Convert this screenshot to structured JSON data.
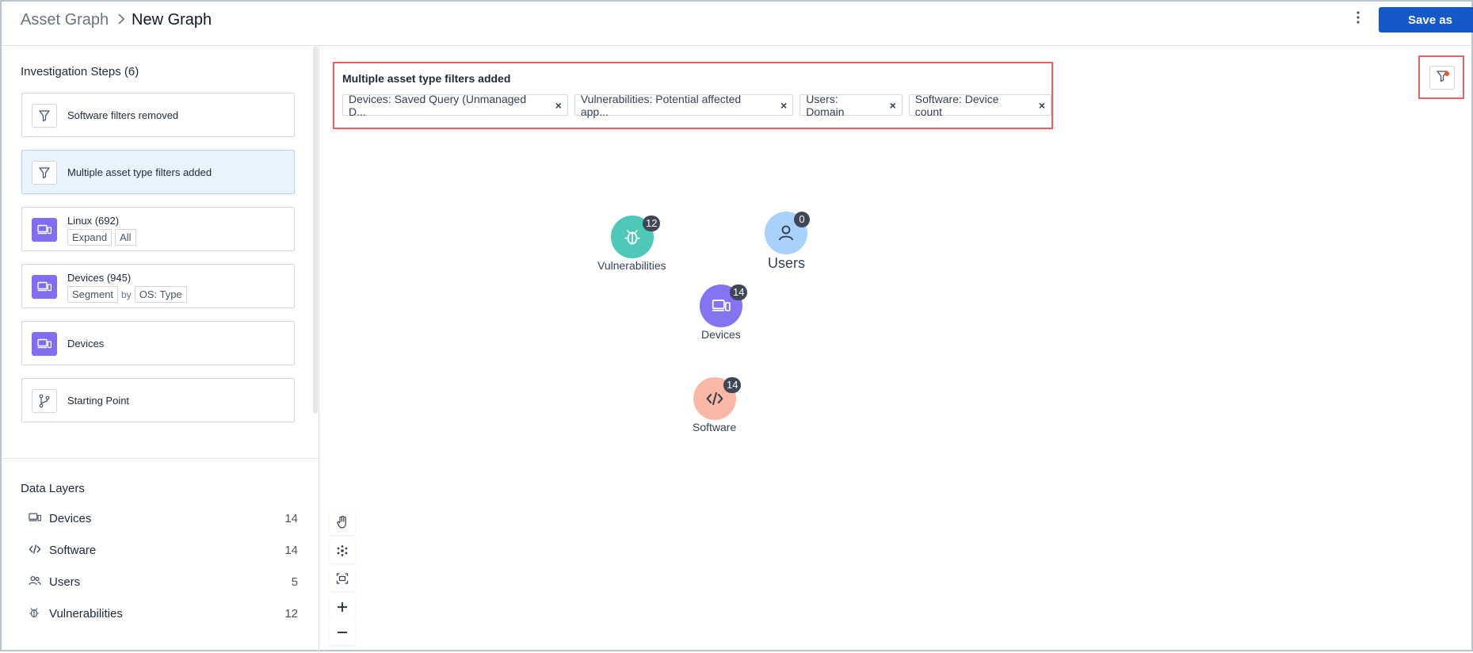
{
  "breadcrumb": {
    "root": "Asset Graph",
    "separator": ">",
    "current": "New Graph"
  },
  "header": {
    "more_icon": "kebab-icon",
    "save_label": "Save as"
  },
  "steps": {
    "title": "Investigation Steps (6)",
    "items": [
      {
        "label": "Software filters removed",
        "icon": "filter-icon"
      },
      {
        "label": "Multiple asset type filters added",
        "icon": "filter-icon"
      },
      {
        "label": "Linux (692)",
        "icon": "devices-icon",
        "chips": [
          "Expand",
          "All"
        ]
      },
      {
        "label": "Devices (945)",
        "icon": "devices-icon",
        "chips": [
          "Segment",
          "OS: Type"
        ],
        "connector": "by"
      },
      {
        "label": "Devices",
        "icon": "devices-icon"
      },
      {
        "label": "Starting Point",
        "icon": "branch-icon"
      }
    ]
  },
  "data_layers": {
    "title": "Data Layers",
    "items": [
      {
        "name": "Devices",
        "count": "14",
        "icon": "devices-icon"
      },
      {
        "name": "Software",
        "count": "14",
        "icon": "code-icon"
      },
      {
        "name": "Users",
        "count": "5",
        "icon": "users-icon"
      },
      {
        "name": "Vulnerabilities",
        "count": "12",
        "icon": "bug-icon"
      }
    ]
  },
  "filter_banner": {
    "title": "Multiple asset type filters added",
    "chips": [
      "Devices: Saved Query (Unmanaged D...",
      "Vulnerabilities: Potential affected app...",
      "Users: Domain",
      "Software: Device count"
    ],
    "remove_glyph": "×"
  },
  "graph": {
    "nodes": [
      {
        "name": "Vulnerabilities",
        "count": "12",
        "color": "#4ec9b7"
      },
      {
        "name": "Users",
        "count": "0",
        "color": "#a8d2fb"
      },
      {
        "name": "Devices",
        "count": "14",
        "color": "#8474f1"
      },
      {
        "name": "Software",
        "count": "14",
        "color": "#f9b8a6"
      }
    ]
  },
  "tools": [
    "pan-hand-icon",
    "layout-icon",
    "fit-view-icon",
    "zoom-in-icon",
    "zoom-out-icon"
  ],
  "colors": {
    "accent": "#1559c9",
    "highlight": "#e26464",
    "step_icon": "#7f6ff0",
    "badge": "#3f4756"
  }
}
